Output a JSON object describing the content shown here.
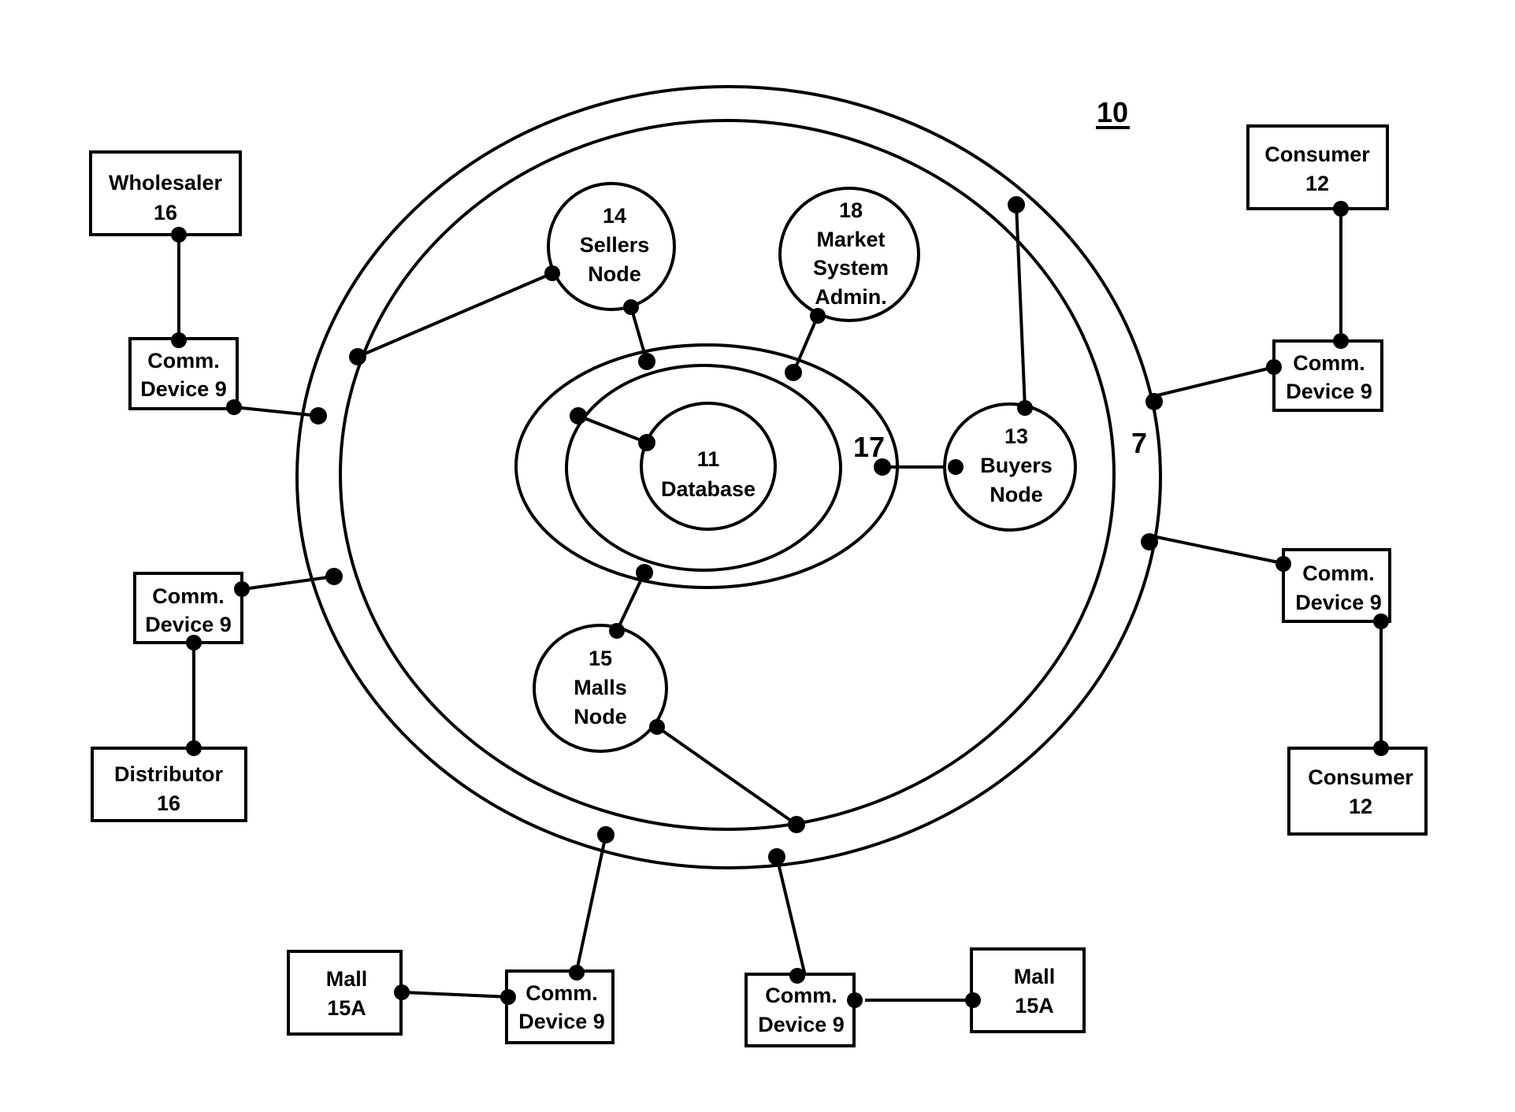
{
  "figure": {
    "reference_label": "10",
    "outer_ring_label": "7",
    "core_ring_label": "17"
  },
  "nodes": {
    "database": {
      "lines": [
        "11",
        "Database"
      ]
    },
    "sellers": {
      "lines": [
        "14",
        "Sellers",
        "Node"
      ]
    },
    "market_admin": {
      "lines": [
        "18",
        "Market",
        "System",
        "Admin."
      ]
    },
    "buyers": {
      "lines": [
        "13",
        "Buyers",
        "Node"
      ]
    },
    "malls": {
      "lines": [
        "15",
        "Malls",
        "Node"
      ]
    }
  },
  "boxes": {
    "wholesaler": {
      "lines": [
        "Wholesaler",
        "16"
      ]
    },
    "distributor": {
      "lines": [
        "Distributor",
        "16"
      ]
    },
    "consumer_top": {
      "lines": [
        "Consumer",
        "12"
      ]
    },
    "consumer_bottom": {
      "lines": [
        "Consumer",
        "12"
      ]
    },
    "mall_left": {
      "lines": [
        "Mall",
        "15A"
      ]
    },
    "mall_right": {
      "lines": [
        "Mall",
        "15A"
      ]
    },
    "comm_upper_left": {
      "lines": [
        "Comm.",
        "Device 9"
      ]
    },
    "comm_lower_left": {
      "lines": [
        "Comm.",
        "Device 9"
      ]
    },
    "comm_upper_right": {
      "lines": [
        "Comm.",
        "Device 9"
      ]
    },
    "comm_lower_right": {
      "lines": [
        "Comm.",
        "Device 9"
      ]
    },
    "comm_bottom_left": {
      "lines": [
        "Comm.",
        "Device 9"
      ]
    },
    "comm_bottom_right": {
      "lines": [
        "Comm.",
        "Device 9"
      ]
    }
  },
  "connections": [
    [
      "wholesaler",
      "comm_upper_left"
    ],
    [
      "comm_upper_left",
      "outer_ring"
    ],
    [
      "outer_ring",
      "sellers"
    ],
    [
      "sellers",
      "core_ring"
    ],
    [
      "market_admin",
      "core_ring"
    ],
    [
      "outer_ring",
      "buyers"
    ],
    [
      "database",
      "core_ring"
    ],
    [
      "core_ring",
      "buyers"
    ],
    [
      "core_ring",
      "malls"
    ],
    [
      "malls",
      "outer_ring"
    ],
    [
      "consumer_top",
      "comm_upper_right"
    ],
    [
      "comm_upper_right",
      "outer_ring"
    ],
    [
      "outer_ring",
      "comm_lower_right"
    ],
    [
      "comm_lower_right",
      "consumer_bottom"
    ],
    [
      "comm_lower_left",
      "outer_ring"
    ],
    [
      "comm_lower_left",
      "distributor"
    ],
    [
      "outer_ring",
      "comm_bottom_left"
    ],
    [
      "mall_left",
      "comm_bottom_left"
    ],
    [
      "outer_ring",
      "comm_bottom_right"
    ],
    [
      "comm_bottom_right",
      "mall_right"
    ]
  ]
}
